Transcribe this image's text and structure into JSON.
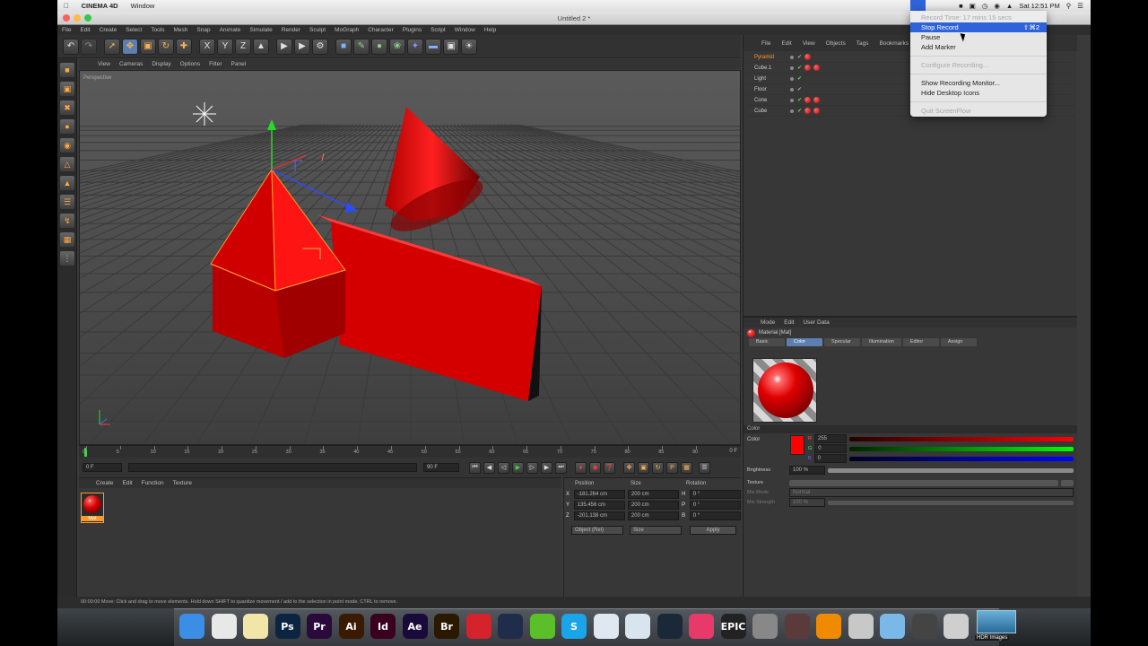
{
  "mac_menubar": {
    "app_name": "CINEMA 4D",
    "menus": [
      "Window"
    ],
    "clock": "Sat 12:51 PM"
  },
  "window": {
    "title": "Untitled 2 *"
  },
  "c4d_menu": [
    "File",
    "Edit",
    "Create",
    "Select",
    "Tools",
    "Mesh",
    "Snap",
    "Animate",
    "Simulate",
    "Render",
    "Sculpt",
    "MoGraph",
    "Character",
    "Plugins",
    "Script",
    "Window",
    "Help"
  ],
  "viewport": {
    "menu": [
      "View",
      "Cameras",
      "Display",
      "Options",
      "Filter",
      "Panel"
    ],
    "label": "Perspective"
  },
  "timeline": {
    "ticks": [
      "0",
      "5",
      "10",
      "15",
      "20",
      "25",
      "30",
      "35",
      "40",
      "45",
      "50",
      "55",
      "60",
      "65",
      "70",
      "75",
      "80",
      "85",
      "90"
    ],
    "end_label": "0 F"
  },
  "transport": {
    "current_frame": "0 F",
    "start_field": "0 F",
    "end_field": "90 F"
  },
  "material_manager": {
    "menu": [
      "Create",
      "Edit",
      "Function",
      "Texture"
    ],
    "material_label": "Mat"
  },
  "coordinates": {
    "headers": [
      "Position",
      "Size",
      "Rotation"
    ],
    "rows": [
      {
        "axis": "X",
        "pos": "-181.264 cm",
        "size": "200 cm",
        "rot_axis": "H",
        "rot": "0 °"
      },
      {
        "axis": "Y",
        "pos": "135.456 cm",
        "size": "200 cm",
        "rot_axis": "P",
        "rot": "0 °"
      },
      {
        "axis": "Z",
        "pos": "-201.138 cm",
        "size": "200 cm",
        "rot_axis": "B",
        "rot": "0 °"
      }
    ],
    "mode_select": "Object (Rel)",
    "size_select": "Size",
    "apply_label": "Apply"
  },
  "object_manager": {
    "menu": [
      "File",
      "Edit",
      "View",
      "Objects",
      "Tags",
      "Bookmarks"
    ],
    "objects": [
      {
        "name": "Pyramid",
        "selected": true,
        "tags": 1
      },
      {
        "name": "Cube.1",
        "selected": false,
        "tags": 2
      },
      {
        "name": "Light",
        "selected": false,
        "tags": 0
      },
      {
        "name": "Floor",
        "selected": false,
        "tags": 0
      },
      {
        "name": "Cone",
        "selected": false,
        "tags": 2
      },
      {
        "name": "Cube",
        "selected": false,
        "tags": 2
      }
    ]
  },
  "attributes": {
    "menu": [
      "Mode",
      "Edit",
      "User Data"
    ],
    "material_title": "Material [Mat]",
    "tabs": [
      "Basic",
      "Color",
      "Specular",
      "Illumination",
      "Editor",
      "Assign"
    ],
    "active_tab": "Color",
    "section": "Color",
    "color_label": "Color",
    "r_value": "255",
    "g_value": "0",
    "b_value": "0",
    "brightness_label": "Brightness",
    "brightness_value": "100 %",
    "texture_label": "Texture",
    "mix_mode_label": "Mix Mode",
    "mix_mode_value": "Normal",
    "mix_strength_label": "Mix Strength",
    "mix_strength_value": "100 %",
    "accent_red": "#ff0000"
  },
  "status_bar": "00:00:00  Move: Click and drag to move elements. Hold down SHIFT to quantize movement / add to the selection in point mode, CTRL to remove.",
  "screenflow_menu": {
    "items": [
      {
        "label": "Record Time: 17 mins 15 secs",
        "disabled": true,
        "highlighted": false,
        "shortcut": ""
      },
      {
        "label": "Stop Record",
        "disabled": false,
        "highlighted": true,
        "shortcut": "⇧⌘2"
      },
      {
        "label": "Pause",
        "disabled": false,
        "highlighted": false,
        "shortcut": ""
      },
      {
        "label": "Add Marker",
        "disabled": false,
        "highlighted": false,
        "shortcut": ""
      },
      {
        "sep": true
      },
      {
        "label": "Configure Recording...",
        "disabled": true,
        "highlighted": false,
        "shortcut": ""
      },
      {
        "sep": true
      },
      {
        "label": "Show Recording Monitor...",
        "disabled": false,
        "highlighted": false,
        "shortcut": ""
      },
      {
        "label": "Hide Desktop Icons",
        "disabled": false,
        "highlighted": false,
        "shortcut": ""
      },
      {
        "sep": true
      },
      {
        "label": "Quit ScreenFlow",
        "disabled": true,
        "highlighted": false,
        "shortcut": ""
      }
    ]
  },
  "dock": {
    "apps": [
      {
        "name": "finder-icon",
        "label": "",
        "color": "#3a8ee6"
      },
      {
        "name": "chrome-icon",
        "label": "",
        "color": "#e8e8e8"
      },
      {
        "name": "notes-icon",
        "label": "",
        "color": "#f1e6a8"
      },
      {
        "name": "photoshop-icon",
        "label": "Ps",
        "color": "#0b2540"
      },
      {
        "name": "premiere-icon",
        "label": "Pr",
        "color": "#2a0a3a"
      },
      {
        "name": "illustrator-icon",
        "label": "Ai",
        "color": "#3a1a00"
      },
      {
        "name": "indesign-icon",
        "label": "Id",
        "color": "#3a0020"
      },
      {
        "name": "aftereffects-icon",
        "label": "Ae",
        "color": "#1a0a3a"
      },
      {
        "name": "bridge-icon",
        "label": "Br",
        "color": "#2a1800"
      },
      {
        "name": "creative-cloud-icon",
        "label": "",
        "color": "#d4232a"
      },
      {
        "name": "cinema4d-icon",
        "label": "",
        "color": "#1f2c4a"
      },
      {
        "name": "utorrent-icon",
        "label": "",
        "color": "#5bbf2a"
      },
      {
        "name": "skype-icon",
        "label": "S",
        "color": "#1aa5e8"
      },
      {
        "name": "messages-icon",
        "label": "",
        "color": "#dfe8f0"
      },
      {
        "name": "preview-icon",
        "label": "",
        "color": "#d8e4ee"
      },
      {
        "name": "steam-icon",
        "label": "",
        "color": "#1b2838"
      },
      {
        "name": "itunes-icon",
        "label": "",
        "color": "#e83a6a"
      },
      {
        "name": "epic-games-icon",
        "label": "EPIC",
        "color": "#222222"
      },
      {
        "name": "disk-utility-icon",
        "label": "",
        "color": "#888888"
      },
      {
        "name": "photo-booth-icon",
        "label": "",
        "color": "#5a3a3a"
      },
      {
        "name": "vlc-icon",
        "label": "",
        "color": "#f08a00"
      },
      {
        "name": "screenflow-icon",
        "label": "",
        "color": "#c8c8c8"
      },
      {
        "name": "folder-icon",
        "label": "",
        "color": "#7ab8e8"
      },
      {
        "name": "downloads-icon",
        "label": "",
        "color": "#444444"
      },
      {
        "name": "trash-icon",
        "label": "",
        "color": "#cfcfcf"
      }
    ],
    "hdr_label": "HDR Images"
  }
}
